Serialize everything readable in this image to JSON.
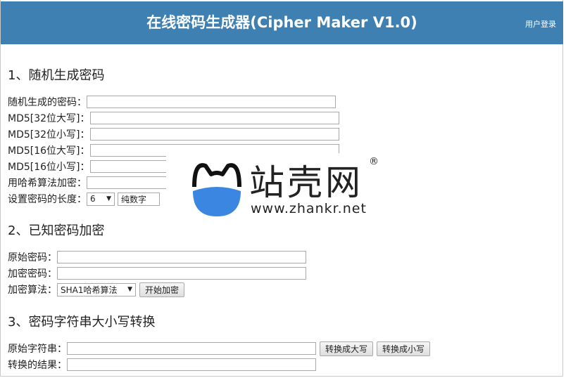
{
  "header": {
    "title": "在线密码生成器(Cipher Maker V1.0)",
    "login": "用户登录"
  },
  "section1": {
    "title": "1、随机生成密码",
    "random_label": "随机生成的密码：",
    "md5_32_upper_label": "MD5[32位大写]：",
    "md5_32_lower_label": "MD5[32位小写]：",
    "md5_16_upper_label": "MD5[16位大写]：",
    "md5_16_lower_label": "MD5[16位小写]：",
    "hash_label": "用哈希算法加密：",
    "length_label": "设置密码的长度：",
    "length_value": "6",
    "type_value": "纯数字"
  },
  "section2": {
    "title": "2、已知密码加密",
    "original_label": "原始密码：",
    "encrypted_label": "加密密码：",
    "algo_label": "加密算法：",
    "algo_value": "SHA1哈希算法",
    "start_button": "开始加密"
  },
  "section3": {
    "title": "3、密码字符串大小写转换",
    "source_label": "原始字符串：",
    "result_label": "转换的结果：",
    "upper_button": "转换成大写",
    "lower_button": "转换成小写"
  },
  "watermark": {
    "brand": "站壳网",
    "registered": "®",
    "url": "www.zhankr.net"
  },
  "colors": {
    "header_bg": "#3f80b3",
    "header_text": "#ffffff",
    "logo_blue": "#3a86e0"
  }
}
